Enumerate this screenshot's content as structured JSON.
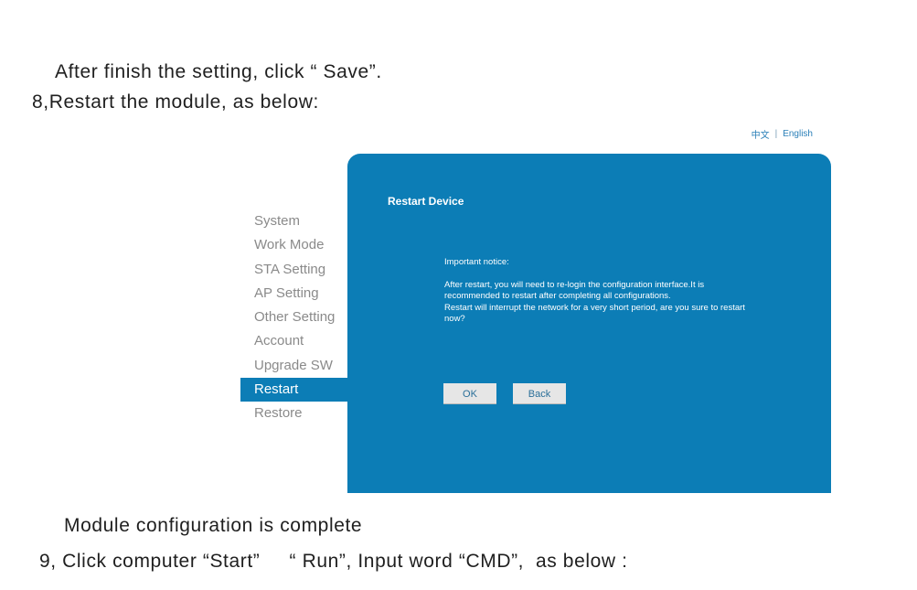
{
  "document": {
    "line1": "After finish the setting, click “ Save”.",
    "line2": "8,Restart the module, as below:",
    "line3": "Module configuration is complete",
    "line4": "9, Click computer “Start”     “ Run”, Input word “CMD”,  as below :"
  },
  "screenshot": {
    "lang": {
      "chinese": "中文",
      "separator": "|",
      "english": "English"
    },
    "sidebar": {
      "items": [
        {
          "label": "System"
        },
        {
          "label": "Work Mode"
        },
        {
          "label": "STA Setting"
        },
        {
          "label": "AP Setting"
        },
        {
          "label": "Other Setting"
        },
        {
          "label": "Account"
        },
        {
          "label": "Upgrade SW"
        },
        {
          "label": "Restart",
          "active": true
        },
        {
          "label": "Restore"
        }
      ]
    },
    "panel": {
      "title": "Restart Device",
      "notice_header": "Important notice:",
      "notice_body1": "After restart, you will need to re-login the configuration interface.It is recommended to restart after completing all configurations.",
      "notice_body2": "Restart will interrupt the network for a very short period, are you sure to restart now?",
      "ok_label": "OK",
      "back_label": "Back"
    },
    "colors": {
      "panel_bg": "#0c7db6",
      "sidebar_text": "#8a8a8a",
      "button_bg": "#e6e6e6"
    }
  }
}
